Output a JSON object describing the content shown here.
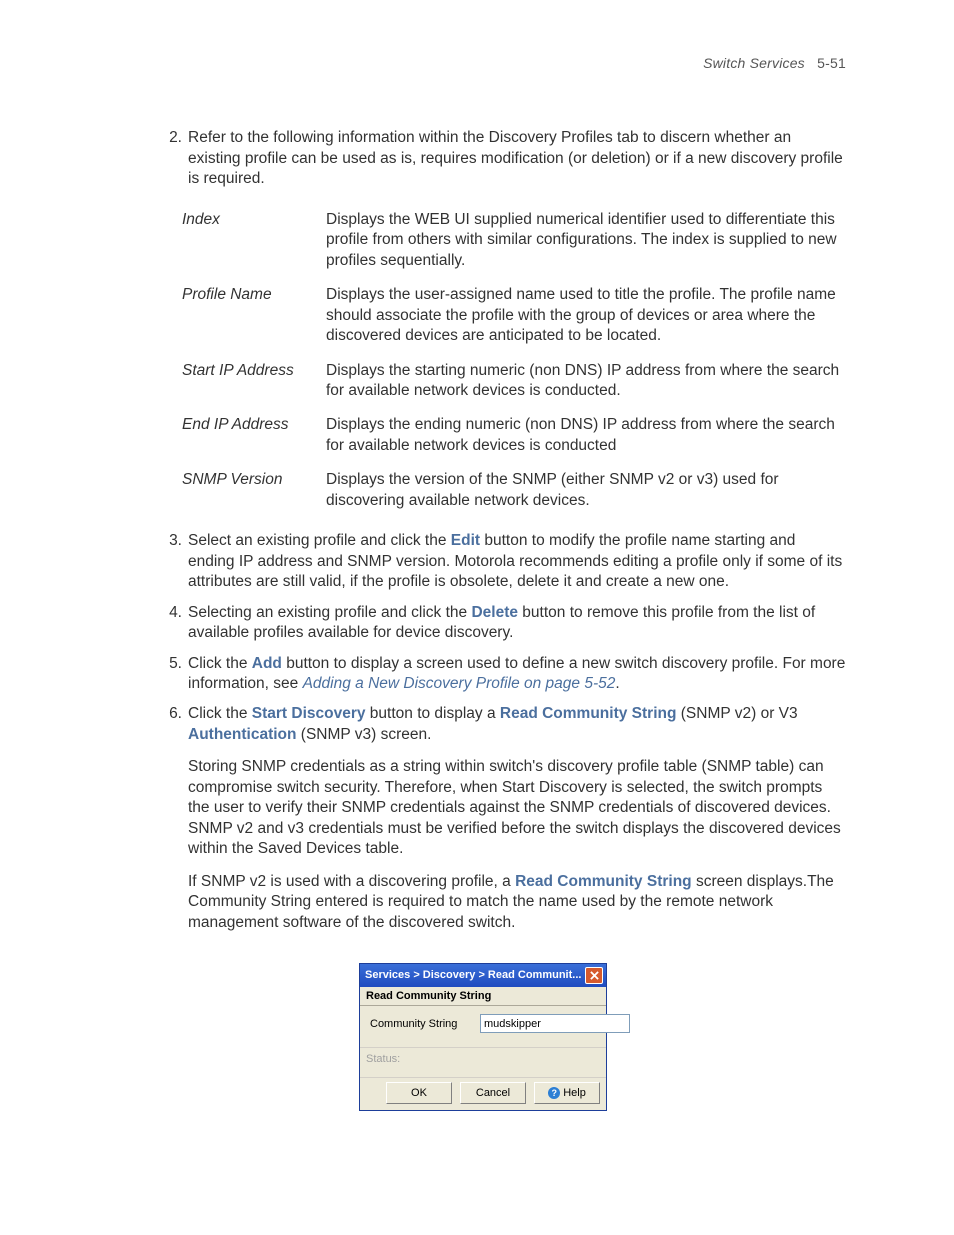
{
  "header": {
    "title": "Switch Services",
    "page": "5-51"
  },
  "steps": {
    "s2": {
      "num": "2.",
      "text": "Refer to the following information within the Discovery Profiles tab to discern whether an existing profile can be used as is, requires modification (or deletion) or if a new discovery profile is required."
    },
    "defs": [
      {
        "term": "Index",
        "desc": "Displays the WEB UI supplied numerical identifier used to differentiate this profile from others with similar configurations. The index is supplied to new profiles sequentially."
      },
      {
        "term": "Profile Name",
        "desc": "Displays the user-assigned name used to title the profile. The profile name should associate the profile with the group of devices or area where the discovered devices are anticipated to be located."
      },
      {
        "term": "Start IP Address",
        "desc": "Displays the starting numeric (non DNS) IP address from where the search for available network devices is conducted."
      },
      {
        "term": "End IP Address",
        "desc": "Displays the ending numeric (non DNS) IP address from where the search for available network devices is conducted"
      },
      {
        "term": "SNMP Version",
        "desc": "Displays the version of the SNMP (either SNMP v2 or v3) used for discovering available network devices."
      }
    ],
    "s3": {
      "num": "3.",
      "pre": "Select an existing profile and click the ",
      "btn": "Edit",
      "post": " button to modify the profile name starting and ending IP address and SNMP version. Motorola recommends editing a profile only if some of its attributes are still valid, if the profile is obsolete, delete it and create a new one."
    },
    "s4": {
      "num": "4.",
      "pre": "Selecting an existing profile and click the ",
      "btn": "Delete",
      "post": " button to remove this profile from the list of available profiles available for device discovery."
    },
    "s5": {
      "num": "5.",
      "pre": "Click the ",
      "btn": "Add",
      "mid": " button to display a screen used to define a new switch discovery profile. For more information, see ",
      "link": "Adding a New Discovery Profile on page 5-52",
      "post": "."
    },
    "s6": {
      "num": "6.",
      "pre": "Click the ",
      "btn1": "Start Discovery",
      "mid1": " button to display a ",
      "btn2": "Read Community String",
      "mid2": " (SNMP v2) or V3 ",
      "btn3": "Authentication",
      "post": " (SNMP v3) screen."
    },
    "s6p2": "Storing SNMP credentials as a string within switch's discovery profile table (SNMP table) can compromise switch security. Therefore, when Start Discovery is selected, the switch prompts the user to verify their SNMP credentials against the SNMP credentials of discovered devices. SNMP v2 and v3 credentials must be verified before the switch displays the discovered devices within the Saved Devices table.",
    "s6p3": {
      "pre": "If SNMP v2 is used with a discovering profile, a ",
      "b": "Read Community String",
      "post": " screen displays.The Community String entered is required to match the name used by the remote network management software of the discovered switch."
    }
  },
  "dialog": {
    "title": "Services > Discovery > Read Communit...",
    "sectionTitle": "Read Community String",
    "fieldLabel": "Community String",
    "fieldValue": "mudskipper",
    "statusLabel": "Status:",
    "ok": "OK",
    "cancel": "Cancel",
    "help": "Help"
  }
}
